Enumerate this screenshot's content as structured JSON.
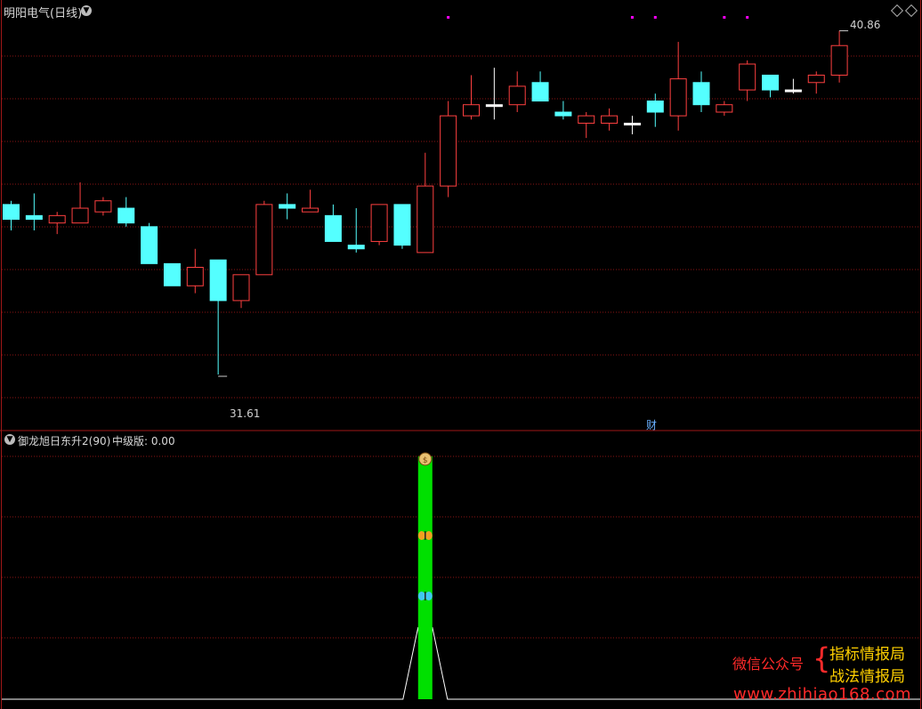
{
  "main_panel": {
    "title": "明阳电气(日线)",
    "high_label": "40.86",
    "low_label": "31.61",
    "cai_marker": "财"
  },
  "indicator_panel": {
    "title": "御龙旭日东升2(90)",
    "value_label": "中级版: 0.00"
  },
  "watermark": {
    "wechat": "微信公众号",
    "brace": "{",
    "line1": "指标情报局",
    "line2": "战法情报局",
    "url": "www.zhihiao168.com"
  },
  "colors": {
    "up": "#ff4040",
    "down": "#54ffff",
    "grid": "#8a1414",
    "indicator_bar": "#00e000",
    "signal_dots": "#ff00ff"
  },
  "icons": [
    "collapse-icon",
    "diamond-icon",
    "money-bag-icon",
    "butterfly-icon"
  ],
  "chart_data": {
    "type": "candlestick",
    "price_range": [
      30.6,
      41.6
    ],
    "candles": [
      {
        "o": 36.5,
        "h": 36.6,
        "l": 35.8,
        "c": 36.1
      },
      {
        "o": 36.2,
        "h": 36.8,
        "l": 35.8,
        "c": 36.1
      },
      {
        "o": 36.0,
        "h": 36.3,
        "l": 35.7,
        "c": 36.2
      },
      {
        "o": 36.0,
        "h": 37.1,
        "l": 36.0,
        "c": 36.4
      },
      {
        "o": 36.3,
        "h": 36.7,
        "l": 36.2,
        "c": 36.6
      },
      {
        "o": 36.4,
        "h": 36.7,
        "l": 35.9,
        "c": 36.0
      },
      {
        "o": 35.9,
        "h": 36.0,
        "l": 34.9,
        "c": 34.9
      },
      {
        "o": 34.9,
        "h": 34.9,
        "l": 34.3,
        "c": 34.3
      },
      {
        "o": 34.3,
        "h": 35.3,
        "l": 34.1,
        "c": 34.8
      },
      {
        "o": 35.0,
        "h": 35.0,
        "l": 31.9,
        "c": 33.9
      },
      {
        "o": 33.9,
        "h": 34.6,
        "l": 33.7,
        "c": 34.6
      },
      {
        "o": 34.6,
        "h": 36.6,
        "l": 34.6,
        "c": 36.5
      },
      {
        "o": 36.5,
        "h": 36.8,
        "l": 36.1,
        "c": 36.4
      },
      {
        "o": 36.3,
        "h": 36.9,
        "l": 36.3,
        "c": 36.4
      },
      {
        "o": 36.2,
        "h": 36.5,
        "l": 35.5,
        "c": 35.5
      },
      {
        "o": 35.4,
        "h": 36.4,
        "l": 35.2,
        "c": 35.3
      },
      {
        "o": 35.5,
        "h": 36.5,
        "l": 35.4,
        "c": 36.5
      },
      {
        "o": 36.5,
        "h": 36.5,
        "l": 35.3,
        "c": 35.4
      },
      {
        "o": 35.2,
        "h": 37.9,
        "l": 35.2,
        "c": 37.0
      },
      {
        "o": 37.0,
        "h": 39.3,
        "l": 36.7,
        "c": 38.9
      },
      {
        "o": 38.9,
        "h": 40.0,
        "l": 38.8,
        "c": 39.2
      },
      {
        "o": 39.2,
        "h": 40.2,
        "l": 38.8,
        "c": 39.2
      },
      {
        "o": 39.2,
        "h": 40.1,
        "l": 39.0,
        "c": 39.7
      },
      {
        "o": 39.8,
        "h": 40.1,
        "l": 39.3,
        "c": 39.3
      },
      {
        "o": 39.0,
        "h": 39.3,
        "l": 38.8,
        "c": 38.9
      },
      {
        "o": 38.7,
        "h": 39.0,
        "l": 38.3,
        "c": 38.9
      },
      {
        "o": 38.7,
        "h": 39.1,
        "l": 38.5,
        "c": 38.9
      },
      {
        "o": 38.7,
        "h": 38.9,
        "l": 38.4,
        "c": 38.7
      },
      {
        "o": 39.3,
        "h": 39.5,
        "l": 38.6,
        "c": 39.0
      },
      {
        "o": 38.9,
        "h": 40.9,
        "l": 38.5,
        "c": 39.9
      },
      {
        "o": 39.8,
        "h": 40.1,
        "l": 39.0,
        "c": 39.2
      },
      {
        "o": 39.0,
        "h": 39.3,
        "l": 38.9,
        "c": 39.2
      },
      {
        "o": 39.6,
        "h": 40.4,
        "l": 39.3,
        "c": 40.3
      },
      {
        "o": 40.0,
        "h": 40.0,
        "l": 39.4,
        "c": 39.6
      },
      {
        "o": 39.6,
        "h": 39.9,
        "l": 39.5,
        "c": 39.6
      },
      {
        "o": 39.8,
        "h": 40.1,
        "l": 39.5,
        "c": 40.0
      },
      {
        "o": 40.0,
        "h": 41.2,
        "l": 39.8,
        "c": 40.8
      }
    ],
    "signal_positions": [
      19,
      27,
      28,
      31,
      32
    ],
    "indicator": {
      "signal_index": 18,
      "bar_value": 1.0,
      "markers": [
        "money-bag",
        "butterfly-orange",
        "butterfly-blue"
      ]
    }
  }
}
